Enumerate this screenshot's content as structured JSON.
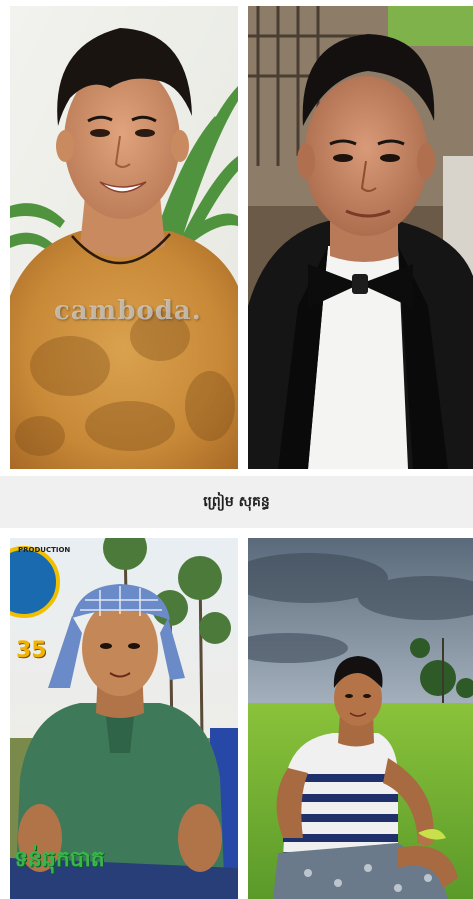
{
  "caption": "ព្រៀម សុគន្ធ",
  "photos": {
    "top_left": {
      "watermark": "camboda."
    },
    "bottom_left": {
      "poster_number": "35",
      "logo_text": "PRODUCTION",
      "poster_title": "ទន់ឆុកបាត"
    }
  }
}
